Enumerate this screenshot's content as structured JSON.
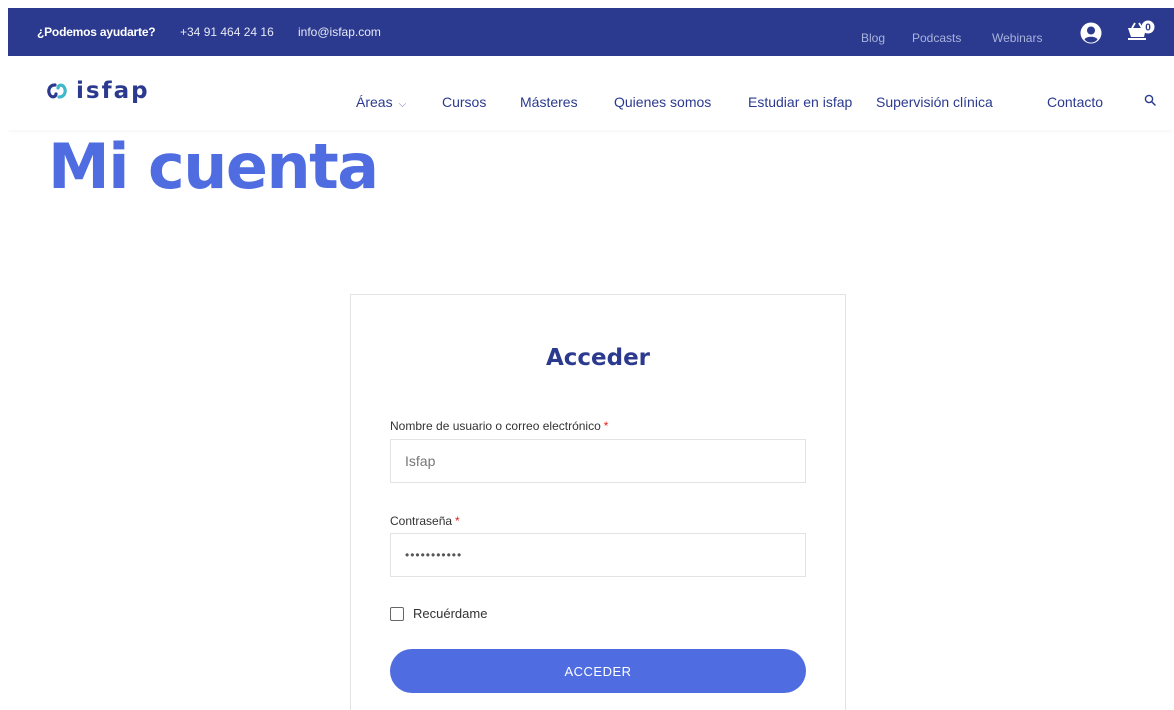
{
  "topbar": {
    "help_text": "¿Podemos ayudarte?",
    "phone": "+34 91 464 24 16",
    "email": "info@isfap.com",
    "links": {
      "blog": "Blog",
      "podcasts": "Podcasts",
      "webinars": "Webinars"
    },
    "cart_count": "0",
    "icons": {
      "user": "user-circle-icon",
      "cart": "cart-icon"
    }
  },
  "nav": {
    "logo_text": "isfap",
    "items": {
      "areas": "Áreas",
      "cursos": "Cursos",
      "masteres": "Másteres",
      "quienes": "Quienes somos",
      "estudiar": "Estudiar en isfap",
      "supervision": "Supervisión clínica",
      "contacto": "Contacto"
    },
    "areas_chevron": "⌵",
    "search_icon": "search-icon"
  },
  "page": {
    "title": "Mi cuenta"
  },
  "login": {
    "heading": "Acceder",
    "username_label": "Nombre de usuario o correo electrónico",
    "username_value": "Isfap",
    "password_label": "Contraseña",
    "password_value": "•••••••••••",
    "required_mark": "*",
    "remember_label": "Recuérdame",
    "submit_label": "ACCEDER"
  },
  "colors": {
    "topbar_bg": "#2b3a8f",
    "accent": "#4f6de0",
    "navy": "#2b3a8f",
    "required": "#e2231a"
  }
}
